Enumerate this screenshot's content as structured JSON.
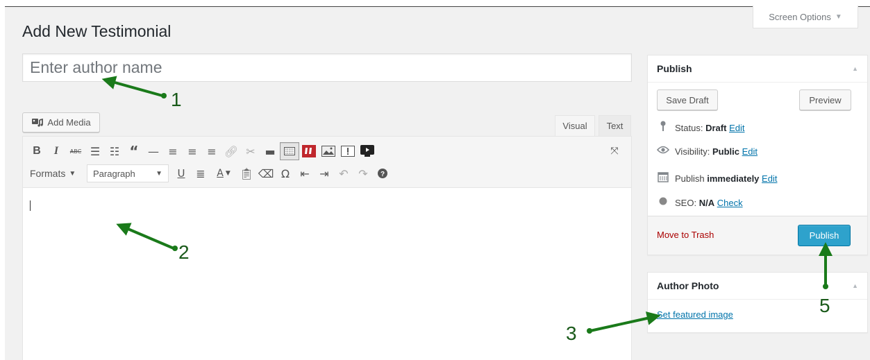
{
  "page": {
    "title": "Add New Testimonial"
  },
  "screen_options": {
    "label": "Screen Options"
  },
  "title_field": {
    "placeholder": "Enter author name",
    "value": ""
  },
  "media": {
    "add_media_label": "Add Media"
  },
  "editor_tabs": {
    "visual": "Visual",
    "text": "Text",
    "active": "Visual"
  },
  "toolbar": {
    "formats_label": "Formats",
    "paragraph_select": "Paragraph",
    "row1_icons": [
      "bold-icon",
      "italic-icon",
      "strikethrough-icon",
      "bullet-list-icon",
      "numbered-list-icon",
      "blockquote-icon",
      "horizontal-rule-icon",
      "align-left-icon",
      "align-center-icon",
      "align-right-icon",
      "insert-link-icon",
      "remove-link-icon",
      "read-more-icon",
      "toolbar-toggle-icon",
      "testimonial-shortcode-icon",
      "insert-image-icon",
      "alert-icon",
      "video-icon"
    ],
    "row2_icons": [
      "underline-icon",
      "justify-icon",
      "text-color-icon",
      "paste-as-text-icon",
      "clear-formatting-icon",
      "special-character-icon",
      "decrease-indent-icon",
      "increase-indent-icon",
      "undo-icon",
      "redo-icon",
      "help-icon"
    ],
    "active_icon": "toolbar-toggle-icon"
  },
  "publish": {
    "heading": "Publish",
    "save_draft": "Save Draft",
    "preview": "Preview",
    "status_label": "Status:",
    "status_value": "Draft",
    "visibility_label": "Visibility:",
    "visibility_value": "Public",
    "publish_label": "Publish",
    "publish_value": "immediately",
    "seo_label": "SEO:",
    "seo_value": "N/A",
    "edit_link": "Edit",
    "check_link": "Check",
    "move_to_trash": "Move to Trash",
    "publish_button": "Publish"
  },
  "author_photo": {
    "heading": "Author Photo",
    "set_featured_image": "Set featured image"
  },
  "annotations": {
    "n1": "1",
    "n2": "2",
    "n3": "3",
    "n5": "5"
  },
  "colors": {
    "arrow": "#1a7a1a",
    "publish_button": "#2ea2cc",
    "link": "#0073aa",
    "trash": "#aa0000"
  }
}
